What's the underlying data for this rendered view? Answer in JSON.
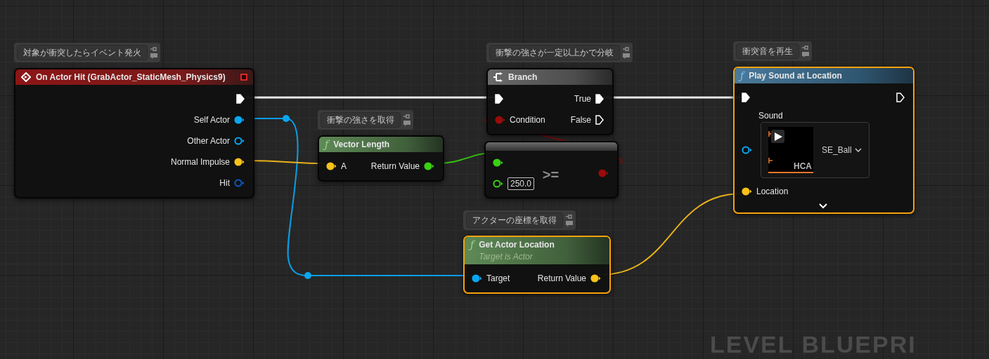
{
  "graph_label": "LEVEL BLUEPRI",
  "nodes": [
    {
      "kind": "event",
      "title": "On Actor Hit (GrabActor_StaticMesh_Physics9)",
      "comment": "対象が衝突したらイベント発火",
      "selected": false,
      "outputs": [
        {
          "kind": "exec",
          "connected": true
        },
        {
          "kind": "object",
          "label": "Self Actor",
          "connected": true
        },
        {
          "kind": "object",
          "label": "Other Actor",
          "connected": false
        },
        {
          "kind": "vector",
          "label": "Normal Impulse",
          "connected": true
        },
        {
          "kind": "struct",
          "label": "Hit",
          "connected": false
        }
      ]
    },
    {
      "kind": "pure_function",
      "glyph": "ƒ",
      "title": "Vector Length",
      "comment": "衝撃の強さを取得",
      "selected": false,
      "inputs": [
        {
          "kind": "vector",
          "label": "A",
          "connected": true
        }
      ],
      "outputs": [
        {
          "kind": "float",
          "label": "Return Value",
          "connected": true
        }
      ]
    },
    {
      "kind": "branch",
      "title": "Branch",
      "comment": "衝撃の強さが一定以上かで分岐",
      "selected": false,
      "inputs": [
        {
          "kind": "exec",
          "connected": true
        },
        {
          "kind": "bool",
          "label": "Condition",
          "connected": true
        }
      ],
      "outputs": [
        {
          "kind": "exec",
          "label": "True",
          "connected": true
        },
        {
          "kind": "exec",
          "label": "False",
          "connected": false
        }
      ]
    },
    {
      "kind": "operator",
      "title": ">=",
      "selected": false,
      "inputs": [
        {
          "kind": "float",
          "connected": true
        },
        {
          "kind": "float",
          "connected": false,
          "value": "250.0"
        }
      ],
      "outputs": [
        {
          "kind": "bool",
          "connected": true
        }
      ]
    },
    {
      "kind": "function",
      "glyph": "ƒ",
      "title": "Play Sound at Location",
      "comment": "衝突音を再生",
      "selected": true,
      "expandable": true,
      "asset": {
        "label": "Sound",
        "value": "SE_Ball",
        "thumb": "HCA",
        "connected": false
      },
      "inputs": [
        {
          "kind": "exec",
          "connected": true
        },
        {
          "kind": "vector",
          "label": "Location",
          "connected": true
        }
      ],
      "outputs": [
        {
          "kind": "exec",
          "connected": false
        }
      ]
    },
    {
      "kind": "pure_function",
      "glyph": "ƒ",
      "title": "Get Actor Location",
      "subtitle": "Target is Actor",
      "comment": "アクターの座標を取得",
      "selected": true,
      "inputs": [
        {
          "kind": "object",
          "label": "Target",
          "connected": true
        }
      ],
      "outputs": [
        {
          "kind": "vector",
          "label": "Return Value",
          "connected": true
        }
      ]
    }
  ]
}
